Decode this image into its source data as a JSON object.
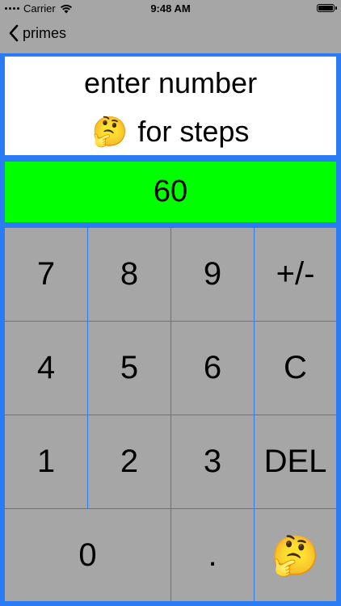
{
  "status_bar": {
    "carrier": "Carrier",
    "time": "9:48 AM"
  },
  "nav": {
    "back_label": "primes"
  },
  "prompt": {
    "line1": "enter number",
    "emoji": "🤔",
    "line2_text": "for steps"
  },
  "display": {
    "value": "60"
  },
  "keypad": {
    "k7": "7",
    "k8": "8",
    "k9": "9",
    "sign": "+/-",
    "k4": "4",
    "k5": "5",
    "k6": "6",
    "clear": "C",
    "k1": "1",
    "k2": "2",
    "k3": "3",
    "delete": "DEL",
    "k0": "0",
    "dot": ".",
    "steps_emoji": "🤔"
  },
  "colors": {
    "frame": "#2a7cf5",
    "display_bg": "#00ff00",
    "key_bg": "#a6a6a6",
    "panel_bg": "#ffffff"
  }
}
